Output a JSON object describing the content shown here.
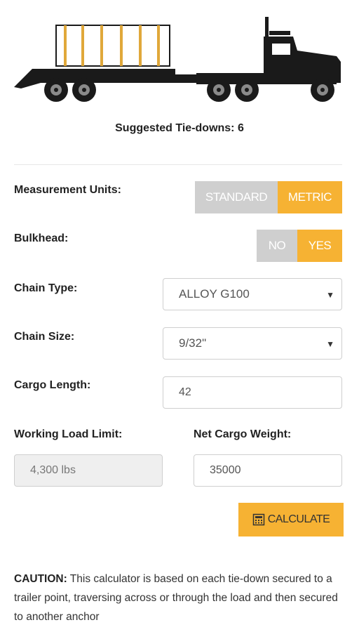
{
  "header": {
    "suggested_label": "Suggested Tie-downs: 6"
  },
  "measurement_units": {
    "label": "Measurement Units:",
    "options": [
      "STANDARD",
      "METRIC"
    ],
    "selected": "METRIC"
  },
  "bulkhead": {
    "label": "Bulkhead:",
    "options": [
      "NO",
      "YES"
    ],
    "selected": "YES"
  },
  "chain_type": {
    "label": "Chain Type:",
    "value": "ALLOY G100"
  },
  "chain_size": {
    "label": "Chain Size:",
    "value": "9/32\""
  },
  "cargo_length": {
    "label": "Cargo Length:",
    "value": "42"
  },
  "working_load_limit": {
    "label": "Working Load Limit:",
    "value": "4,300 lbs"
  },
  "net_cargo_weight": {
    "label": "Net Cargo Weight:",
    "value": "35000"
  },
  "calculate_button": {
    "label": "CALCULATE",
    "icon": "calculator-icon"
  },
  "caution": {
    "title": "CAUTION:",
    "text": " This calculator is based on each tie-down secured to a trailer point, traversing across or through the load and then secured to another anchor"
  },
  "colors": {
    "accent": "#f6b233",
    "toggle_off": "#cfcfcf",
    "truck": "#1a1a1a",
    "cargo_post": "#e0a83a"
  }
}
